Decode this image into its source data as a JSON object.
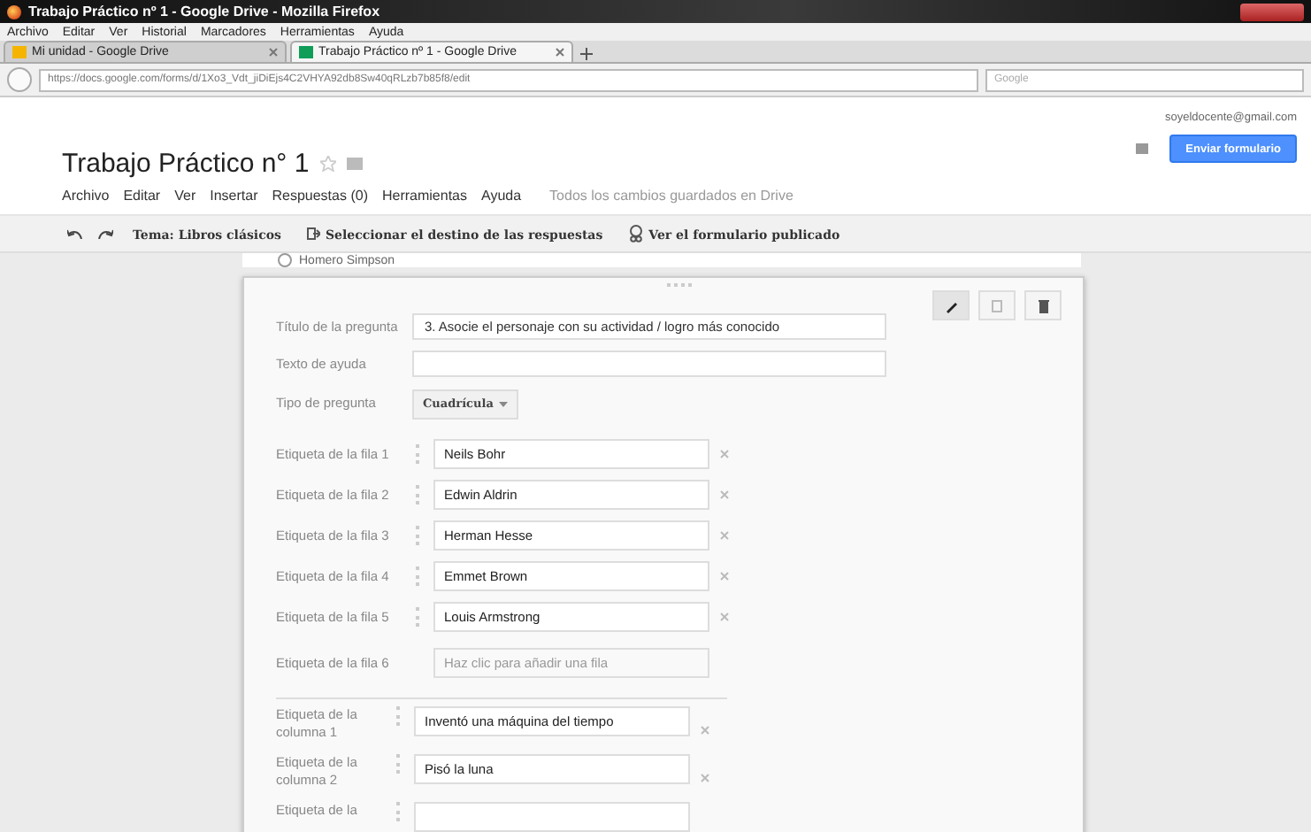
{
  "browser": {
    "title": "Trabajo Práctico nº 1 - Google Drive - Mozilla Firefox",
    "menu": [
      "Archivo",
      "Editar",
      "Ver",
      "Historial",
      "Marcadores",
      "Herramientas",
      "Ayuda"
    ],
    "tabs": [
      {
        "label": "Mi unidad - Google Drive",
        "selected": false
      },
      {
        "label": "Trabajo Práctico nº 1 - Google Drive",
        "selected": true
      }
    ],
    "url": "https://docs.google.com/forms/d/1Xo3_Vdt_jiDiEjs4C2VHYA92db8Sw40qRLzb7b85f8/edit",
    "search_placeholder": "Google"
  },
  "doc": {
    "account": "soyeldocente@gmail.com",
    "title": "Trabajo Práctico n° 1",
    "menu": [
      "Archivo",
      "Editar",
      "Ver",
      "Insertar",
      "Respuestas (0)",
      "Herramientas",
      "Ayuda"
    ],
    "save_status": "Todos los cambios guardados en Drive",
    "send_button": "Enviar formulario",
    "toolbar": [
      {
        "kind": "theme",
        "label": "Tema: Libros clásicos"
      },
      {
        "kind": "destination",
        "label": "Seleccionar el destino de las respuestas"
      },
      {
        "kind": "view",
        "label": "Ver el formulario publicado"
      }
    ]
  },
  "form": {
    "previous_option": {
      "label": "Homero Simpson",
      "selected": false
    },
    "fields": [
      {
        "label": "Título de la pregunta",
        "value": "3. Asocie el personaje con su actividad / logro más conocido"
      },
      {
        "label": "Texto de ayuda"
      }
    ],
    "type_label": "Tipo de pregunta",
    "type_value": "Cuadrícula",
    "rows": [
      {
        "label": "Etiqueta de la fila 1",
        "value": "Neils Bohr"
      },
      {
        "label": "Etiqueta de la fila 2",
        "value": "Edwin Aldrin"
      },
      {
        "label": "Etiqueta de la fila 3",
        "value": "Herman Hesse"
      },
      {
        "label": "Etiqueta de la fila 4",
        "value": "Emmet Brown"
      },
      {
        "label": "Etiqueta de la fila 5",
        "value": "Louis Armstrong"
      }
    ],
    "new_row": {
      "label": "Etiqueta de la fila 6",
      "placeholder": "Haz clic para añadir una fila"
    },
    "columns": [
      {
        "label": "Etiqueta de la columna 1",
        "value": "Inventó una máquina del tiempo"
      },
      {
        "label": "Etiqueta de la columna 2",
        "value": "Pisó la luna"
      },
      {
        "label": "Etiqueta de la"
      }
    ]
  }
}
